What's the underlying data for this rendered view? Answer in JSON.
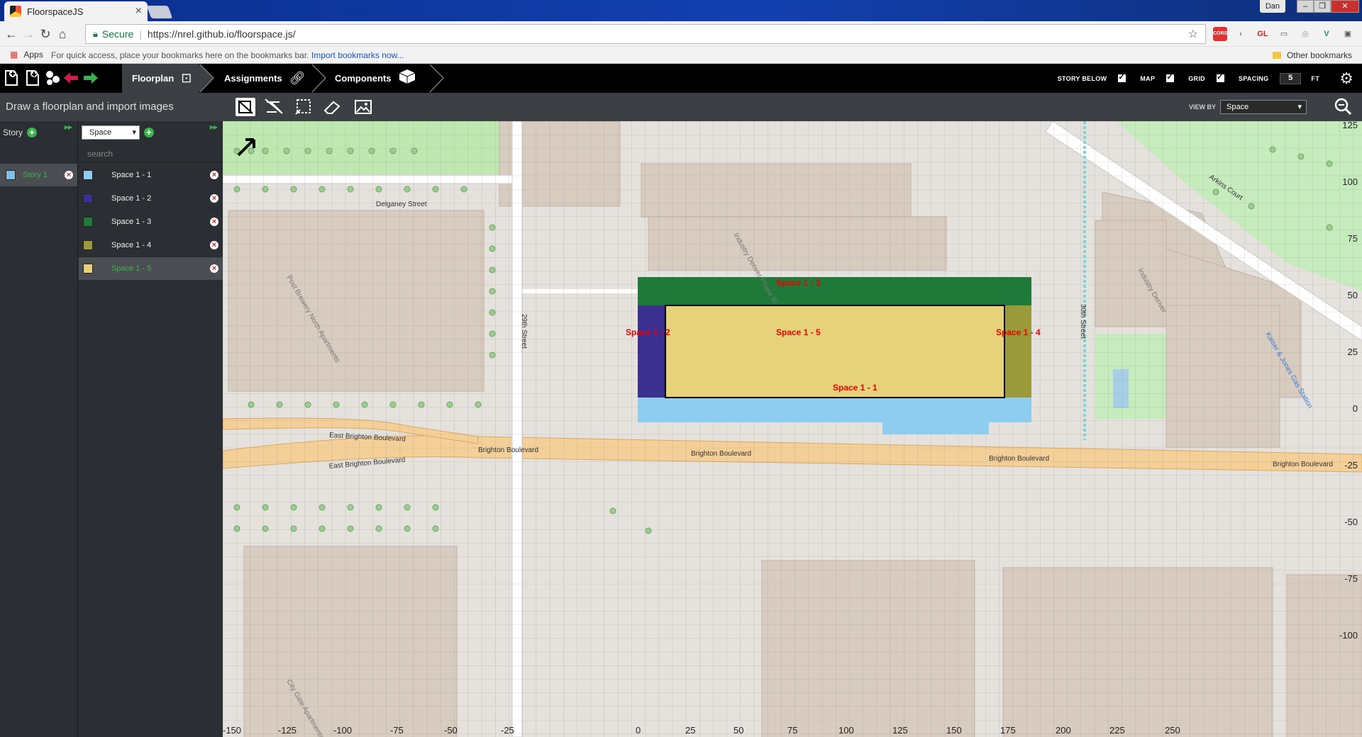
{
  "browser": {
    "tab_title": "FloorspaceJS",
    "tab_close": "×",
    "user": "Dan",
    "window_buttons": [
      "–",
      "❐",
      "✕"
    ],
    "secure_label": "Secure",
    "url": "https://nrel.github.io/floorspace.js/",
    "bookmarks_apps": "Apps",
    "bookmarks_hint": "For quick access, place your bookmarks here on the bookmarks bar.",
    "bookmarks_import": "Import bookmarks now...",
    "other_bookmarks": "Other bookmarks",
    "extensions": [
      "CORS",
      "GL"
    ]
  },
  "app": {
    "modes": [
      {
        "label": "Floorplan",
        "active": true
      },
      {
        "label": "Assignments",
        "active": false
      },
      {
        "label": "Components",
        "active": false
      }
    ],
    "settings": {
      "story_below": "STORY BELOW",
      "map": "MAP",
      "grid": "GRID",
      "spacing": "SPACING",
      "spacing_value": "5",
      "unit": "FT"
    },
    "instructions": "Draw a floorplan and import images",
    "view_by_label": "VIEW BY",
    "view_by_value": "Space"
  },
  "stories": {
    "header": "Story",
    "items": [
      {
        "name": "Story 1",
        "color": "#7fbfe8",
        "selected": true
      }
    ]
  },
  "spaces": {
    "dropdown": "Space",
    "search_placeholder": "search",
    "items": [
      {
        "name": "Space 1 - 1",
        "color": "#8fcdf0"
      },
      {
        "name": "Space 1 - 2",
        "color": "#3b2f8f"
      },
      {
        "name": "Space 1 - 3",
        "color": "#1f7a3a"
      },
      {
        "name": "Space 1 - 4",
        "color": "#9b9a3a"
      },
      {
        "name": "Space 1 - 5",
        "color": "#e6d27a",
        "selected": true
      }
    ]
  },
  "map": {
    "streets": [
      "Delganey Street",
      "29th Street",
      "30th Street",
      "Arkins Court",
      "East Brighton Boulevard",
      "East Brighton Boulevard",
      "Brighton Boulevard",
      "Brighton Boulevard",
      "Brighton Boulevard",
      "Brighton Boulevard"
    ],
    "building_labels": [
      "Post Brewery North Apartments",
      "Industry Denver Phase III",
      "Industry Denver",
      "City Gate Apartments",
      "Kaiser & Jones Gas Station"
    ],
    "space_labels": [
      "Space 1 - 3",
      "Space 1 - 2",
      "Space 1 - 5",
      "Space 1 - 4",
      "Space 1 - 1"
    ],
    "x_ticks": [
      "-150",
      "-125",
      "-100",
      "-75",
      "-50",
      "-25",
      "0",
      "25",
      "50",
      "75",
      "100",
      "125",
      "150",
      "175",
      "200",
      "225",
      "250"
    ],
    "y_ticks": [
      "125",
      "100",
      "75",
      "50",
      "25",
      "0",
      "-25",
      "-50",
      "-75",
      "-100"
    ]
  }
}
